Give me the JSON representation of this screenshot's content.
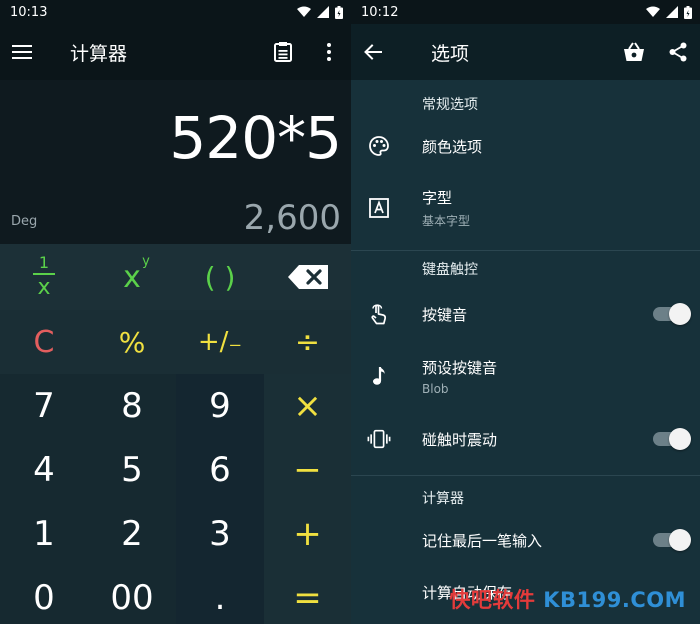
{
  "left": {
    "status_time": "10:13",
    "app_title": "计算器",
    "expression": "520*5",
    "angle_mode": "Deg",
    "result": "2,600",
    "keys": {
      "reciprocal_num": "1",
      "reciprocal_den": "x",
      "power_base": "x",
      "power_exp": "y",
      "parens": "( )",
      "clear": "C",
      "percent": "%",
      "plus_minus": "+/₋",
      "divide": "÷",
      "k7": "7",
      "k8": "8",
      "k9": "9",
      "multiply": "×",
      "k4": "4",
      "k5": "5",
      "k6": "6",
      "minus": "−",
      "k1": "1",
      "k2": "2",
      "k3": "3",
      "plus": "+",
      "k0": "0",
      "k00": "00",
      "dot": ".",
      "equals": "="
    }
  },
  "right": {
    "status_time": "10:12",
    "title": "选项",
    "sections": {
      "general": "常规选项",
      "keyboard": "键盘触控",
      "calculator": "计算器"
    },
    "items": {
      "color": "颜色选项",
      "font": "字型",
      "font_sub": "基本字型",
      "key_sound": "按键音",
      "preset_sound": "预设按键音",
      "preset_sound_sub": "Blob",
      "vibrate": "碰触时震动",
      "remember_input": "记住最后一笔输入",
      "autosave": "计算自动保存"
    },
    "toggles": {
      "key_sound": true,
      "vibrate": true,
      "remember_input": true
    }
  },
  "watermark": {
    "part1": "快吧软件",
    "part2": "KB199.COM"
  },
  "colors": {
    "accent_green": "#5bd14a",
    "accent_yellow": "#f0e040",
    "accent_red": "#e35e5e"
  }
}
